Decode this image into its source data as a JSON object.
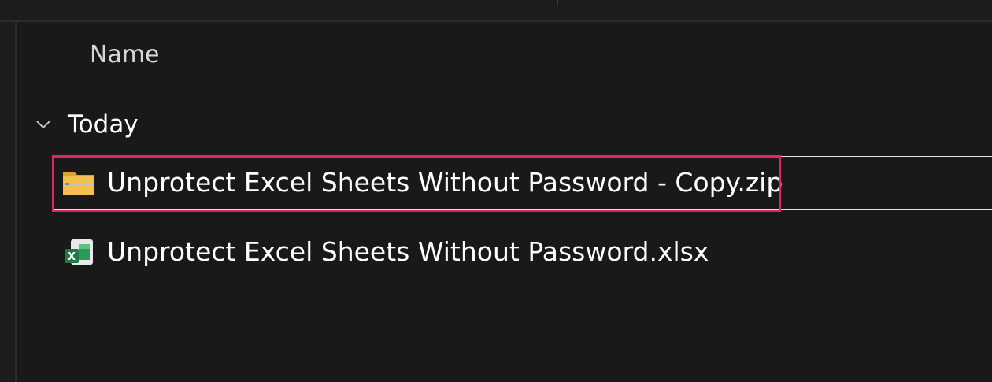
{
  "columns": {
    "name_label": "Name"
  },
  "group": {
    "label": "Today",
    "chevron_icon": "chevron-down-icon"
  },
  "files": [
    {
      "name": "Unprotect Excel Sheets Without Password - Copy.zip",
      "icon": "zip-folder-icon",
      "selected": true
    },
    {
      "name": "Unprotect Excel Sheets Without Password.xlsx",
      "icon": "excel-file-icon",
      "selected": false
    }
  ],
  "colors": {
    "background": "#191919",
    "highlight": "#e0245e",
    "folder": "#f2c14e",
    "excel": "#1d7a45"
  }
}
